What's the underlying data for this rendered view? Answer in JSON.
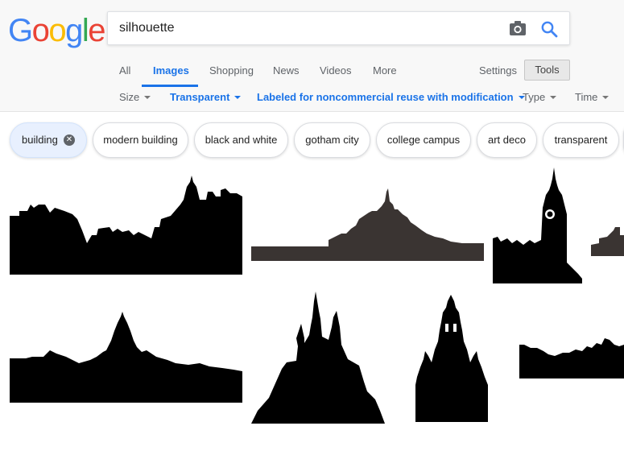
{
  "logo": {
    "letters": [
      "G",
      "o",
      "o",
      "g",
      "l",
      "e"
    ],
    "colors": [
      "#4285f4",
      "#ea4335",
      "#fbbc05",
      "#4285f4",
      "#34a853",
      "#ea4335"
    ]
  },
  "search": {
    "query": "silhouette",
    "camera_icon": "camera-icon",
    "search_icon": "search-icon"
  },
  "nav": {
    "tabs": [
      "All",
      "Images",
      "Shopping",
      "News",
      "Videos",
      "More"
    ],
    "active": "Images",
    "settings": "Settings",
    "tools": "Tools"
  },
  "filters": {
    "size": "Size",
    "color": "Transparent",
    "usage_rights": "Labeled for noncommercial reuse with modification",
    "type": "Type",
    "time": "Time"
  },
  "chips": {
    "selected": "building",
    "items": [
      "modern building",
      "black and white",
      "gotham city",
      "college campus",
      "art deco",
      "transparent"
    ]
  },
  "colors": {
    "accent": "#1a73e8",
    "chip_selected_bg": "#e8f0fe",
    "silhouette": "#000000",
    "silhouette_gray": "#3a3432"
  }
}
